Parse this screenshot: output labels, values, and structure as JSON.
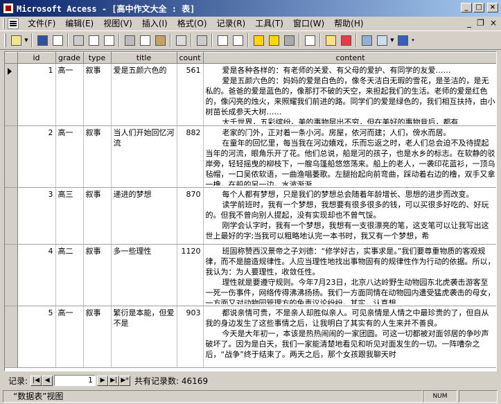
{
  "window": {
    "title": "Microsoft Access - [高中作文大全 : 表]"
  },
  "menu": [
    "文件(F)",
    "编辑(E)",
    "视图(V)",
    "插入(I)",
    "格式(O)",
    "记录(R)",
    "工具(T)",
    "窗口(W)",
    "帮助(H)"
  ],
  "table": {
    "columns": [
      "id",
      "grade",
      "type",
      "title",
      "count",
      "content"
    ],
    "rows": [
      {
        "id": "1",
        "grade": "高一",
        "type": "叙事",
        "title": "爱是五颜六色的",
        "count": "561",
        "content": [
          "爱是各种各样的：有老师的关爱、有父母的爱护、有同学的友爱……",
          "爱是五颜六色的：妈妈的爱是白色的，像冬天洁白无瑕的雪花，是圣洁的，是无私的。爸爸的爱是蓝色的，像那打不破的天空，来担起我们的生活。老师的爱是红色的，像闪亮的烛火，来照耀我们前进的路。同学们的爱是绿色的，我们相互扶持，由小树苗长成参天大树……",
          "大千世界，五彩缤纷，美的事物层出不穷，但在美好的事物背后，都有"
        ]
      },
      {
        "id": "2",
        "grade": "高一",
        "type": "叙事",
        "title": "当人们开始回忆河流",
        "count": "882",
        "content": [
          "老家的门外，正对着一条小河。房屋，依河而建；人们，傍水而居。",
          "在童年的回忆里，每当我在河边嬉戏，乐而忘返之时，老人们总会迫不及待提起当年的河流，眼角乐开了花。他们总说，船是河的孩子，也是水乡的标志。在软静的驳岸旁，轻轻摇曳的柳枝下，一艘乌篷船悠悠荡来。船上的老人，一袭印花蓝衫，一顶乌毡帽，一口吴侬软语，一曲渔唱萎歌。左腿抬起向前弯曲，踩动着右边的橹，双手又拿一橹，在船的另一边，水波渐渐"
        ]
      },
      {
        "id": "3",
        "grade": "高三",
        "type": "叙事",
        "title": "递进的梦想",
        "count": "870",
        "content": [
          "每个人都有梦想，只是我们的梦想总会随着年龄增长、思想的进步而改变。",
          "读学前班时，我有一个梦想，我想要有很多很多的钱，可以买很多好吃的、好玩的。但我不曾向别人提起，没有实现却也不曾气馁。",
          "刚学会认字时，我有一个梦想，我想有一支很漂亮的笔，这支笔可以让我写出这世上最好的字;当我可以粗略地认完一本书时，我又有一个梦想，希"
        ]
      },
      {
        "id": "4",
        "grade": "高二",
        "type": "叙事",
        "title": "多一些理性",
        "count": "1120",
        "content": [
          "班固称赞西汉景帝之子刘德：“修学好古，实事求是。”我们要尊重物质的客观规律，而不是臆造规律性。人应当理性地找出事物固有的规律性作为行动的依据。所以，我认为：为人要理性，收敛任性。",
          "理性就是要遵守规则。今年7月23日，北京八达岭野生动物园东北虎袭击游客至一死一伤事件，网络传得沸沸扬扬。我们一方面同情在动物园内遭受猛虎袭击的母女，一方面又对动物园管理方的免责议论纷纷。其实，认真想"
        ]
      },
      {
        "id": "5",
        "grade": "高一",
        "type": "叙事",
        "title": "繁衍是本能，但爱不是",
        "count": "903",
        "content": [
          "都说亲情可贵，不是亲人却胜似亲人。可见亲情是人情之中最珍贵的了，但自从我的身边发生了这些事情之后，让我明白了其实有的人生来并不善良。",
          "今天是大年初一，本该是热热闹闹的一家团圆。可这一切都被对面邻居的争吵声破坏了。因为是白天，我们一家能清楚地看见和听见对面发生的一切。一阵嘈杂之后，“战争”终于结束了。两天之后，那个女孩跟我聊天时"
        ]
      }
    ]
  },
  "nav": {
    "label": "记录:",
    "current": "1",
    "total_label": "共有记录数: 46169"
  },
  "status": {
    "view": "“数据表”视图",
    "num": "NUM"
  }
}
